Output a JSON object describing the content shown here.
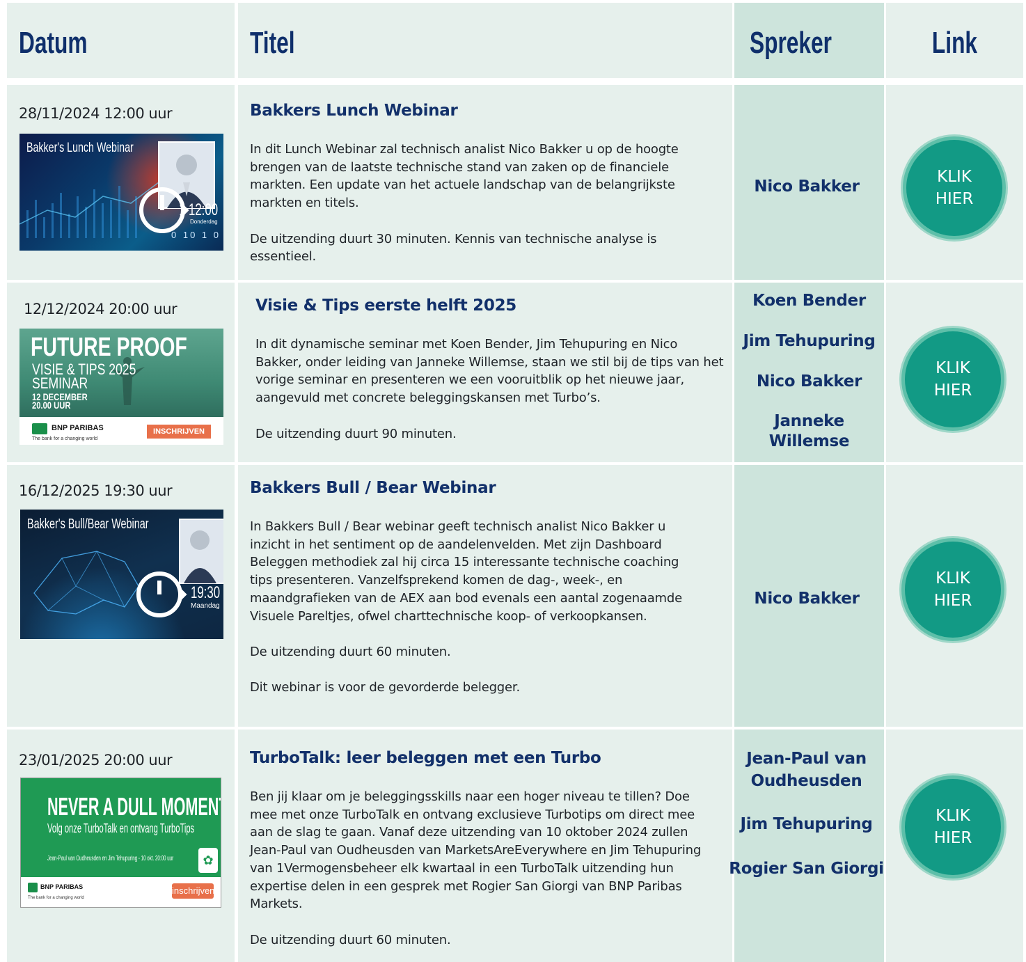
{
  "header": {
    "col_date": "Datum",
    "col_title": "Titel",
    "col_speaker": "Spreker",
    "col_link": "Link"
  },
  "colors": {
    "accent": "#129a85",
    "text_dark": "#12306a",
    "bg_light": "#e6f0ec",
    "bg_speaker": "#cde4dc"
  },
  "rows": [
    {
      "date": "28/11/2024 12:00 uur",
      "title": "Bakkers Lunch Webinar",
      "desc": [
        "In dit Lunch Webinar zal technisch analist Nico Bakker u op de hoogte brengen van de laatste technische stand van zaken op de financiele markten. Een update van het actuele landschap van de belangrijkste markten en titels.",
        "De uitzending duurt 30 minuten. Kennis van technische analyse is essentieel."
      ],
      "speakers": [
        "Nico Bakker"
      ],
      "link_l1": "KLIK",
      "link_l2": "HIER",
      "thumb": {
        "title": "Bakker's Lunch Webinar",
        "time": "12:00",
        "day": "Donderdag",
        "digits": "0 10 1 0",
        "icon": "presenter-portrait-clock-icon"
      }
    },
    {
      "date": "12/12/2024 20:00 uur",
      "title": "Visie & Tips eerste helft 2025",
      "desc": [
        "In dit dynamische seminar met Koen Bender, Jim Tehupuring en Nico Bakker, onder leiding van Janneke Willemse, staan we stil bij de tips van het vorige seminar en presenteren we een vooruitblik op het nieuwe jaar, aangevuld met concrete beleggingskansen met Turbo’s.",
        "De uitzending duurt 90 minuten."
      ],
      "speakers": [
        "Koen Bender",
        "Jim Tehupuring",
        "Nico Bakker",
        "Janneke Willemse"
      ],
      "link_l1": "KLIK",
      "link_l2": "HIER",
      "thumb": {
        "line1": "FUTURE PROOF",
        "line2": "VISIE & TIPS 2025",
        "line3": "SEMINAR",
        "line4": "12 DECEMBER",
        "line5": "20.00 UUR",
        "brand": "BNP PARIBAS",
        "tagline": "The bank for a changing world",
        "cta": "INSCHRIJVEN"
      }
    },
    {
      "date": "16/12/2025 19:30 uur",
      "title": "Bakkers Bull / Bear Webinar",
      "desc": [
        "In Bakkers Bull / Bear webinar geeft technisch analist Nico Bakker u inzicht in het sentiment op de aandelenvelden. Met zijn Dashboard Beleggen methodiek zal hij circa 15 interessante technische coaching tips presenteren. Vanzelfsprekend komen de dag-, week-, en maandgrafieken van de AEX aan bod evenals een aantal zogenaamde Visuele Pareltjes, ofwel charttechnische koop- of verkoopkansen.",
        "De uitzending duurt 60 minuten.",
        "Dit webinar is voor de gevorderde belegger."
      ],
      "speakers": [
        "Nico Bakker"
      ],
      "link_l1": "KLIK",
      "link_l2": "HIER",
      "thumb": {
        "title": "Bakker's Bull/Bear Webinar",
        "time": "19:30",
        "day": "Maandag",
        "icon": "bull-bear-globe-icon"
      }
    },
    {
      "date": "23/01/2025 20:00 uur",
      "title": "TurboTalk: leer beleggen met een Turbo",
      "desc": [
        "Ben jij klaar om je beleggingsskills naar een hoger niveau te tillen? Doe mee met onze TurboTalk en ontvang exclusieve Turbotips om direct mee aan de slag te gaan.  Vanaf deze uitzending van 10 oktober 2024 zullen Jean-Paul van Oudheusden van MarketsAreEverywhere en Jim Tehupuring van 1Vermogensbeheer elk kwartaal in een TurboTalk uitzending hun expertise delen in een gesprek met Rogier San Giorgi van BNP Paribas Markets.",
        "De uitzending duurt 60 minuten."
      ],
      "speakers": [
        "Jean-Paul van Oudheusden",
        "Jim Tehupuring",
        "Rogier San Giorgi"
      ],
      "link_l1": "KLIK",
      "link_l2": "HIER",
      "thumb": {
        "line1": "NEVER A DULL MOMENT",
        "line2": "Volg onze TurboTalk en ontvang TurboTips",
        "line3": "Jean-Paul van Oudheusden en Jim Tehupuring - 10 okt. 20:00 uur",
        "brand": "BNP PARIBAS",
        "tagline": "The bank for a changing world",
        "cta": "inschrijven"
      }
    }
  ]
}
